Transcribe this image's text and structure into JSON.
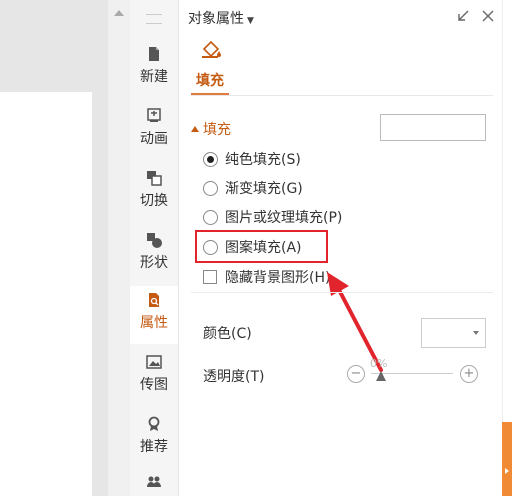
{
  "panel": {
    "title": "对象属性",
    "tab_fill": "填充",
    "section_fill": "填充"
  },
  "sidebar": {
    "items": [
      {
        "label": "新建",
        "icon": "new-file-icon"
      },
      {
        "label": "动画",
        "icon": "animation-icon"
      },
      {
        "label": "切换",
        "icon": "transition-icon"
      },
      {
        "label": "形状",
        "icon": "shape-icon"
      },
      {
        "label": "属性",
        "icon": "properties-icon"
      },
      {
        "label": "传图",
        "icon": "upload-image-icon"
      },
      {
        "label": "推荐",
        "icon": "recommend-icon"
      }
    ],
    "active": "属性"
  },
  "fill_options": [
    {
      "label": "纯色填充(S)",
      "selected": true
    },
    {
      "label": "渐变填充(G)",
      "selected": false
    },
    {
      "label": "图片或纹理填充(P)",
      "selected": false
    },
    {
      "label": "图案填充(A)",
      "selected": false
    }
  ],
  "hide_background": {
    "label": "隐藏背景图形(H)",
    "checked": false
  },
  "color": {
    "label": "颜色(C)"
  },
  "transparency": {
    "label": "透明度(T)",
    "value": "0%",
    "minus": "−",
    "plus": "+"
  },
  "colors": {
    "accent": "#c55a11",
    "highlight": "#e2242c",
    "orange_bar": "#f08a35"
  }
}
